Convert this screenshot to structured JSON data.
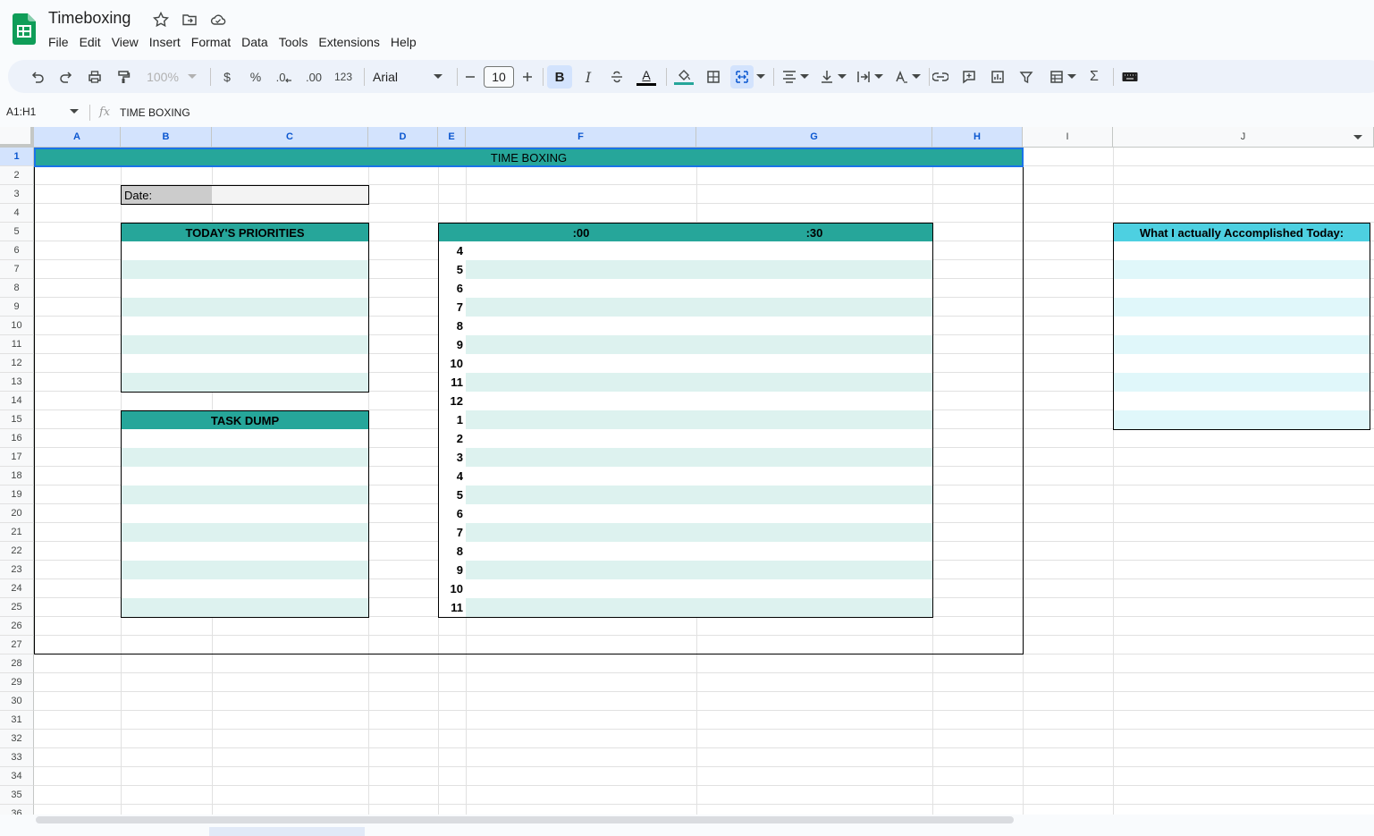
{
  "doc": {
    "title": "Timeboxing"
  },
  "menu": [
    "File",
    "Edit",
    "View",
    "Insert",
    "Format",
    "Data",
    "Tools",
    "Extensions",
    "Help"
  ],
  "toolbar": {
    "zoom": "100%",
    "currency": "$",
    "percent": "%",
    "dec_decrease": ".0",
    "dec_increase": ".00",
    "number_format": "123",
    "font": "Arial",
    "font_size": "10",
    "bold": "B",
    "italic": "I",
    "text_color": "A"
  },
  "formula_bar": {
    "name_box": "A1:H1",
    "fx": "fx",
    "content": "TIME BOXING"
  },
  "columns": [
    "A",
    "B",
    "C",
    "D",
    "E",
    "F",
    "G",
    "H",
    "I",
    "J"
  ],
  "rows": [
    "1",
    "2",
    "3",
    "4",
    "5",
    "6",
    "7",
    "8",
    "9",
    "10",
    "11",
    "12",
    "13",
    "14",
    "15",
    "16",
    "17",
    "18",
    "19",
    "20",
    "21",
    "22",
    "23",
    "24",
    "25",
    "26",
    "27",
    "28",
    "29",
    "30",
    "31",
    "32",
    "33",
    "34",
    "35",
    "36"
  ],
  "sheet": {
    "title": "TIME BOXING",
    "date_label": "Date:",
    "priorities_header": "TODAY'S PRIORITIES",
    "task_dump_header": "TASK DUMP",
    "col_00": ":00",
    "col_30": ":30",
    "accomplished_header": "What I actually Accomplished Today:",
    "hours": [
      "4",
      "5",
      "6",
      "7",
      "8",
      "9",
      "10",
      "11",
      "12",
      "1",
      "2",
      "3",
      "4",
      "5",
      "6",
      "7",
      "8",
      "9",
      "10",
      "11"
    ]
  },
  "colors": {
    "teal": "#26a69a",
    "cyan": "#4dd0e1",
    "mint": "#ddf2ef",
    "selection": "#d3e3fd"
  }
}
